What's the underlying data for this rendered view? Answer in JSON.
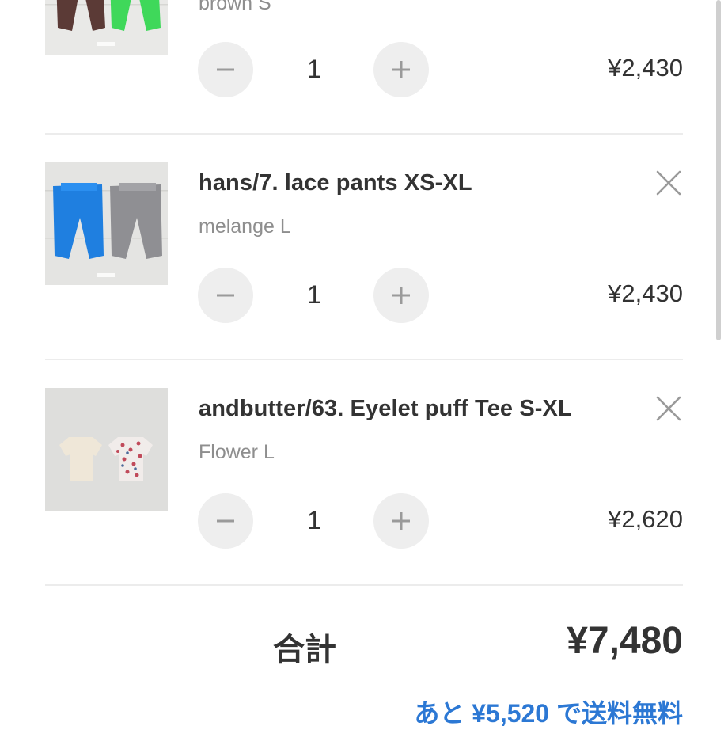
{
  "cart": {
    "items": [
      {
        "name": "",
        "variant": "brown S",
        "quantity": "1",
        "price": "¥2,430",
        "thumbnail": "brown and green pants photo"
      },
      {
        "name": "hans/7. lace pants XS-XL",
        "variant": "melange L",
        "quantity": "1",
        "price": "¥2,430",
        "thumbnail": "blue and grey pants photo"
      },
      {
        "name": "andbutter/63. Eyelet puff Tee S-XL",
        "variant": "Flower L",
        "quantity": "1",
        "price": "¥2,620",
        "thumbnail": "cream and floral tees photo"
      }
    ],
    "total_label": "合計",
    "total_value": "¥7,480",
    "free_shipping_message": "あと ¥5,520 で送料無料"
  },
  "icons": {
    "decrease": "minus-icon",
    "increase": "plus-icon",
    "remove": "close-icon"
  },
  "colors": {
    "accent": "#2c78d4",
    "text": "#333333",
    "muted": "#8e8e8e",
    "button_bg": "#eeeeee",
    "divider": "#ececec"
  }
}
